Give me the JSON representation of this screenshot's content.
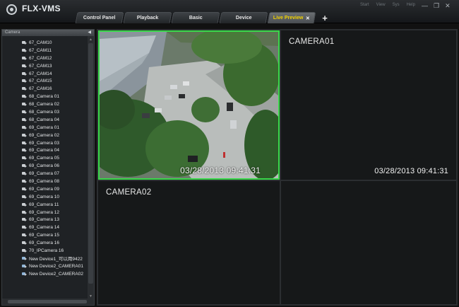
{
  "app": {
    "title": "FLX-VMS"
  },
  "tabs": [
    {
      "label": "Control Panel",
      "active": false
    },
    {
      "label": "Playback",
      "active": false
    },
    {
      "label": "Basic",
      "active": false
    },
    {
      "label": "Device",
      "active": false
    },
    {
      "label": "Live Preview",
      "active": true
    }
  ],
  "top_menu": [
    "Start",
    "View",
    "Sys",
    "Help"
  ],
  "sidebar": {
    "header": "Camera",
    "items": [
      "67_CAM10",
      "67_CAM11",
      "67_CAM12",
      "67_CAM13",
      "67_CAM14",
      "67_CAM15",
      "67_CAM16",
      "68_Camera 01",
      "68_Camera 02",
      "68_Camera 03",
      "68_Camera 04",
      "69_Camera 01",
      "69_Camera 02",
      "69_Camera 03",
      "69_Camera 04",
      "69_Camera 05",
      "69_Camera 06",
      "69_Camera 07",
      "69_Camera 08",
      "69_Camera 09",
      "69_Camera 10",
      "69_Camera 11",
      "69_Camera 12",
      "69_Camera 13",
      "69_Camera 14",
      "69_Camera 15",
      "69_Camera 16",
      "70_IPCamera 16",
      "New Device1_可以用9422",
      "New Device2_CAMERA01",
      "New Device2_CAMERA02"
    ]
  },
  "panes": [
    {
      "label": "",
      "timestamp": "03/28/2013  09:41:31"
    },
    {
      "label": "CAMERA01",
      "timestamp": "03/28/2013 09:41:31"
    },
    {
      "label": "CAMERA02",
      "timestamp": ""
    },
    {
      "label": "",
      "timestamp": ""
    }
  ],
  "colors": {
    "selected_border": "#39d84a",
    "active_tab_text": "#f2d200",
    "background": "#111111"
  }
}
